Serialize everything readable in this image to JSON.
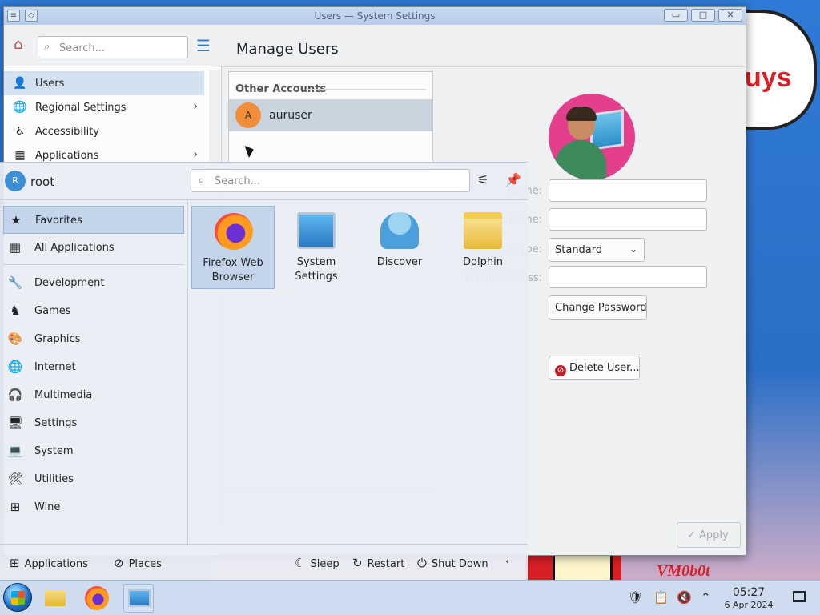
{
  "window": {
    "title": "Users — System Settings",
    "minimize_icon": "▭",
    "maximize_icon": "□",
    "close_icon": "✕"
  },
  "wallpaper": {
    "bubble_text": "uys",
    "bottom_text": "VM0b0t"
  },
  "sidebar": {
    "search_placeholder": "Search...",
    "items": [
      {
        "label": "Users",
        "icon": "users-icon",
        "active": true
      },
      {
        "label": "Regional Settings",
        "icon": "globe-icon",
        "chevron": true
      },
      {
        "label": "Accessibility",
        "icon": "accessibility-icon"
      },
      {
        "label": "Applications",
        "icon": "applications-icon",
        "chevron": true
      }
    ]
  },
  "main": {
    "title": "Manage Users",
    "accounts_header": "Other Accounts",
    "accounts": [
      {
        "initial": "A",
        "name": "auruser"
      }
    ],
    "form": {
      "name_label": "Name:",
      "username_label": "Username:",
      "account_type_label": "Account type:",
      "account_type_value": "Standard",
      "email_label": "Email address:",
      "name_value": "",
      "username_value": "",
      "email_value": ""
    },
    "change_password_label": "Change Password",
    "delete_user_label": "Delete User...",
    "apply_label": "Apply"
  },
  "launcher": {
    "user_initial": "R",
    "user_name": "root",
    "search_placeholder": "Search...",
    "categories": [
      {
        "label": "Favorites",
        "icon": "favorites-icon",
        "active": true
      },
      {
        "label": "All Applications",
        "icon": "all-applications-icon"
      },
      {
        "label": "Development",
        "icon": "development-icon"
      },
      {
        "label": "Games",
        "icon": "games-icon"
      },
      {
        "label": "Graphics",
        "icon": "graphics-icon"
      },
      {
        "label": "Internet",
        "icon": "internet-icon"
      },
      {
        "label": "Multimedia",
        "icon": "multimedia-icon"
      },
      {
        "label": "Settings",
        "icon": "settings-icon"
      },
      {
        "label": "System",
        "icon": "system-icon"
      },
      {
        "label": "Utilities",
        "icon": "utilities-icon"
      },
      {
        "label": "Wine",
        "icon": "wine-icon"
      }
    ],
    "favorites": [
      {
        "label": "Firefox Web Browser",
        "icon": "firefox-icon",
        "active": true
      },
      {
        "label": "System Settings",
        "icon": "system-settings-icon"
      },
      {
        "label": "Discover",
        "icon": "discover-icon"
      },
      {
        "label": "Dolphin",
        "icon": "dolphin-icon"
      }
    ],
    "bottom": {
      "applications_label": "Applications",
      "places_label": "Places",
      "sleep_label": "Sleep",
      "restart_label": "Restart",
      "shutdown_label": "Shut Down"
    }
  },
  "taskbar": {
    "time": "05:27",
    "date": "6 Apr 2024"
  }
}
